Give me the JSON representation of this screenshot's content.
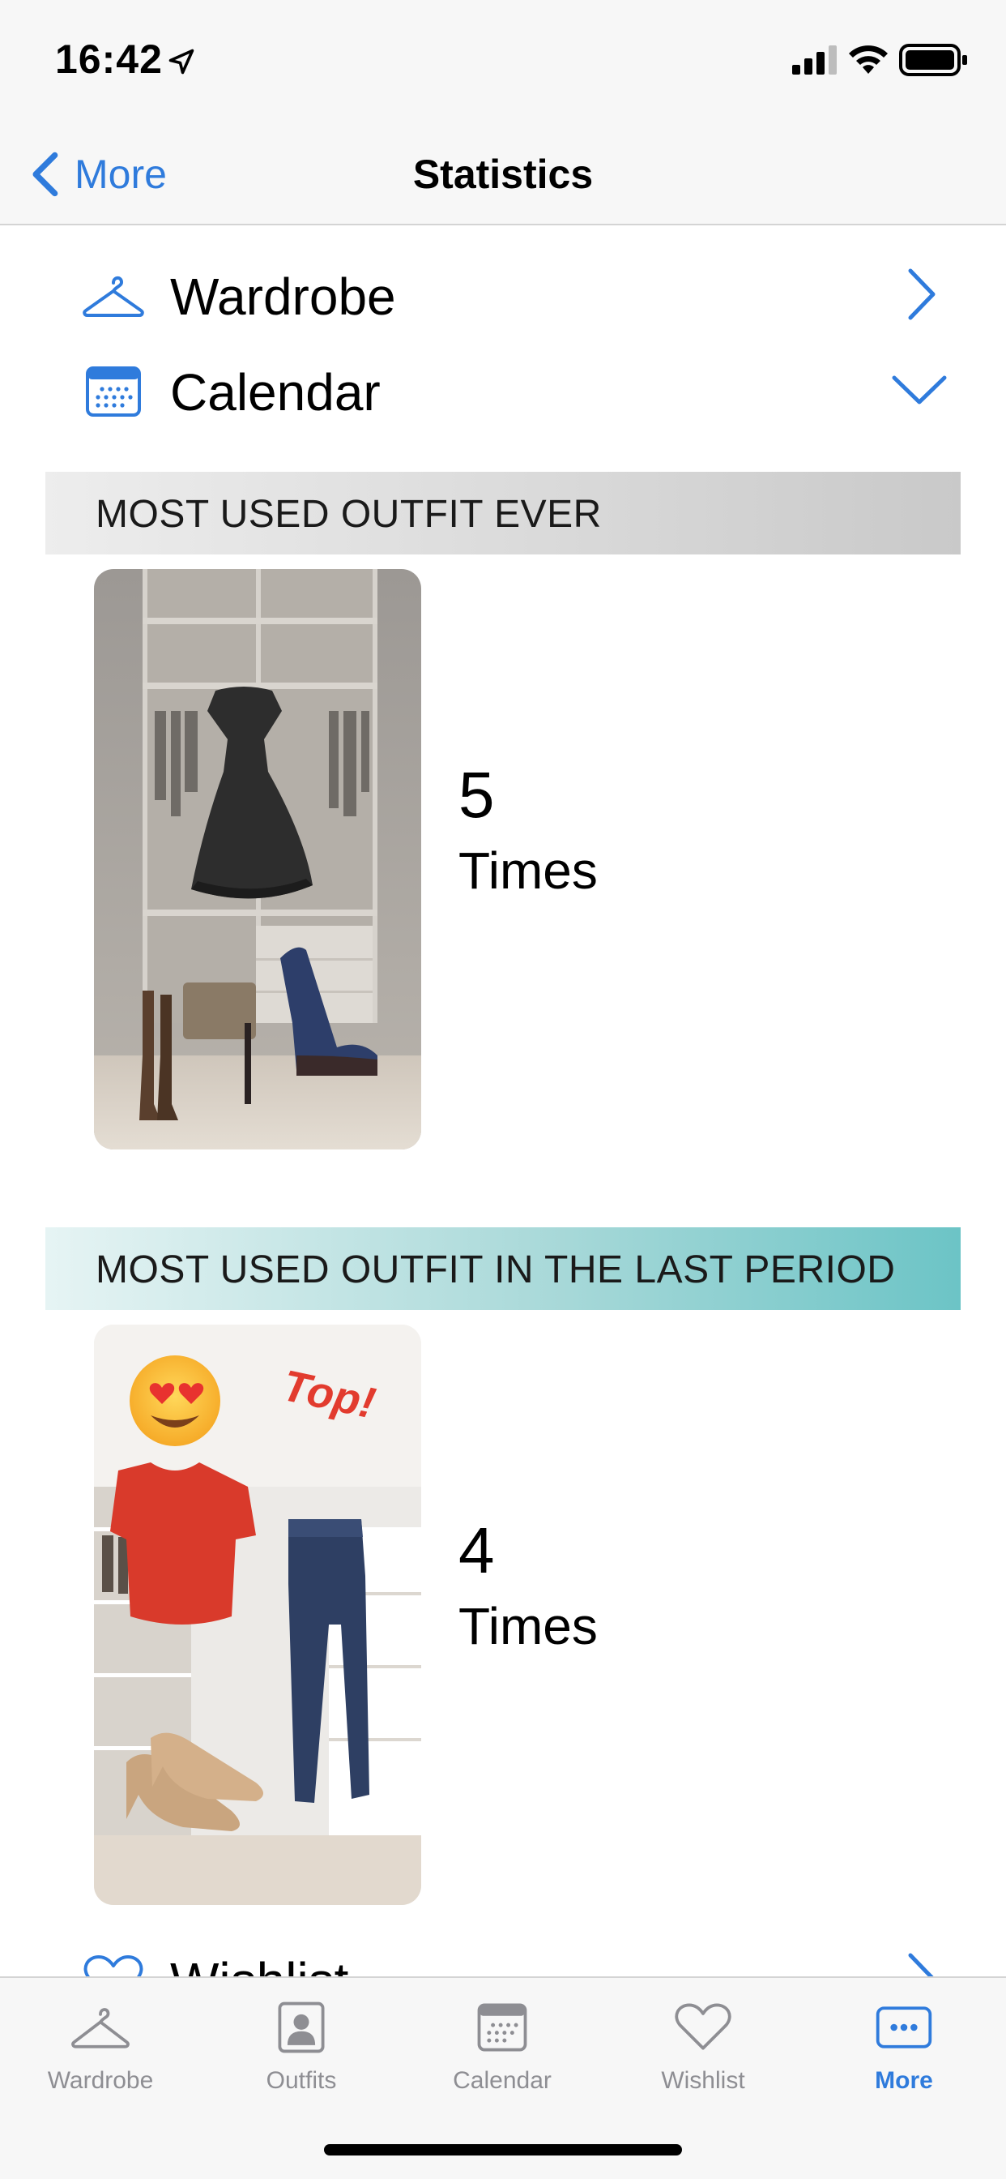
{
  "status_bar": {
    "time": "16:42"
  },
  "nav": {
    "back_label": "More",
    "title": "Statistics"
  },
  "menu": {
    "wardrobe": "Wardrobe",
    "calendar": "Calendar",
    "wishlist": "Wishlist"
  },
  "sections": [
    {
      "title": "MOST USED OUTFIT EVER",
      "count": "5",
      "unit": "Times"
    },
    {
      "title": "MOST USED OUTFIT IN THE LAST PERIOD",
      "count": "4",
      "unit": "Times",
      "sticker": "Top!"
    }
  ],
  "tab_bar": {
    "items": [
      {
        "label": "Wardrobe",
        "icon": "hanger-icon"
      },
      {
        "label": "Outfits",
        "icon": "person-card-icon"
      },
      {
        "label": "Calendar",
        "icon": "calendar-icon"
      },
      {
        "label": "Wishlist",
        "icon": "heart-icon"
      },
      {
        "label": "More",
        "icon": "more-icon"
      }
    ],
    "active": "More"
  },
  "colors": {
    "accent": "#2f7bdc",
    "inactive": "#8e8e93",
    "teal": "#6cc4c6"
  }
}
